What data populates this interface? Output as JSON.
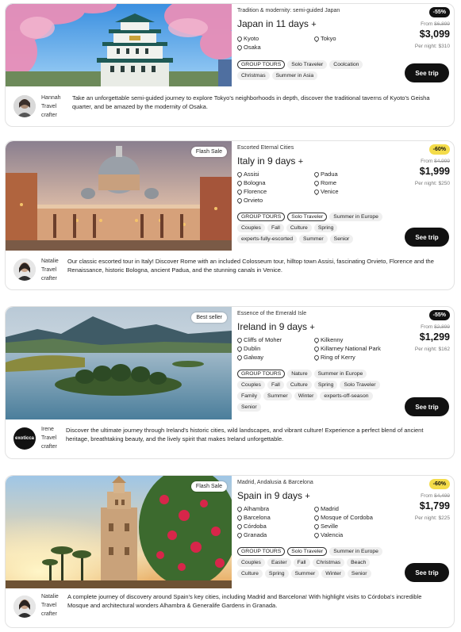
{
  "trips": [
    {
      "flag": "",
      "subtitle": "Tradition & modernity: semi-guided Japan",
      "title": "Japan in 11 days",
      "cities": [
        "Kyoto",
        "Tokyo",
        "Osaka"
      ],
      "tags": [
        {
          "label": "GROUP TOURS",
          "style": "outline"
        },
        {
          "label": "Solo Traveler",
          "style": "fill"
        },
        {
          "label": "Coolcation",
          "style": "fill"
        },
        {
          "label": "Christmas",
          "style": "fill"
        },
        {
          "label": "Summer in Asia",
          "style": "fill"
        }
      ],
      "discount": "-55%",
      "discount_style": "dark",
      "from_label": "From",
      "old_price": "$6,899",
      "price": "$3,099",
      "per_night": "Per night: $310",
      "cta": "See trip",
      "agent": [
        "Hannah",
        "Travel",
        "crafter"
      ],
      "description": "Take an unforgettable semi-guided journey to explore Tokyo's neighborhoods in depth, discover the traditional taverns of Kyoto's Geisha quarter, and be amazed by the modernity of Osaka."
    },
    {
      "flag": "Flash Sale",
      "subtitle": "Escorted Eternal Cities",
      "title": "Italy in 9 days",
      "cities": [
        "Assisi",
        "Padua",
        "Bologna",
        "Rome",
        "Florence",
        "Venice",
        "Orvieto"
      ],
      "tags": [
        {
          "label": "GROUP TOURS",
          "style": "outline"
        },
        {
          "label": "Solo Traveler",
          "style": "outline"
        },
        {
          "label": "Summer in Europe",
          "style": "fill"
        },
        {
          "label": "Couples",
          "style": "fill"
        },
        {
          "label": "Fall",
          "style": "fill"
        },
        {
          "label": "Culture",
          "style": "fill"
        },
        {
          "label": "Spring",
          "style": "fill"
        },
        {
          "label": "experts-fully-escorted",
          "style": "fill"
        },
        {
          "label": "Summer",
          "style": "fill"
        },
        {
          "label": "Senior",
          "style": "fill"
        }
      ],
      "discount": "-60%",
      "discount_style": "yellow",
      "from_label": "From",
      "old_price": "$4,999",
      "price": "$1,999",
      "per_night": "Per night: $250",
      "cta": "See trip",
      "agent": [
        "Natalie",
        "Travel",
        "crafter"
      ],
      "description": "Our classic escorted tour in Italy! Discover Rome with an included Colosseum tour, hilltop town Assisi, fascinating Orvieto, Florence and the Renaissance, historic Bologna, ancient Padua, and the stunning canals in Venice."
    },
    {
      "flag": "Best seller",
      "subtitle": "Essence of the Emerald Isle",
      "title": "Ireland in 9 days",
      "cities": [
        "Cliffs of Moher",
        "Kilkenny",
        "Dublin",
        "Killarney National Park",
        "Galway",
        "Ring of Kerry"
      ],
      "tags": [
        {
          "label": "GROUP TOURS",
          "style": "outline"
        },
        {
          "label": "Nature",
          "style": "fill"
        },
        {
          "label": "Summer in Europe",
          "style": "fill"
        },
        {
          "label": "Couples",
          "style": "fill"
        },
        {
          "label": "Fall",
          "style": "fill"
        },
        {
          "label": "Culture",
          "style": "fill"
        },
        {
          "label": "Spring",
          "style": "fill"
        },
        {
          "label": "Solo Traveler",
          "style": "fill"
        },
        {
          "label": "Family",
          "style": "fill"
        },
        {
          "label": "Summer",
          "style": "fill"
        },
        {
          "label": "Winter",
          "style": "fill"
        },
        {
          "label": "experts-off-season",
          "style": "fill"
        },
        {
          "label": "Senior",
          "style": "fill"
        }
      ],
      "discount": "-55%",
      "discount_style": "dark",
      "from_label": "From",
      "old_price": "$2,899",
      "price": "$1,299",
      "per_night": "Per night: $162",
      "cta": "See trip",
      "agent": [
        "Irene",
        "Travel",
        "crafter"
      ],
      "agent_logo": "exoticca",
      "description": "Discover the ultimate journey through Ireland's historic cities, wild landscapes, and vibrant culture! Experience a perfect blend of ancient heritage, breathtaking beauty, and the lively spirit that makes Ireland unforgettable."
    },
    {
      "flag": "Flash Sale",
      "subtitle": "Madrid, Andalusia & Barcelona",
      "title": "Spain in 9 days",
      "cities": [
        "Alhambra",
        "Madrid",
        "Barcelona",
        "Mosque of Cordoba",
        "Córdoba",
        "Seville",
        "Granada",
        "Valencia"
      ],
      "tags": [
        {
          "label": "GROUP TOURS",
          "style": "outline"
        },
        {
          "label": "Solo Traveler",
          "style": "outline"
        },
        {
          "label": "Summer in Europe",
          "style": "fill"
        },
        {
          "label": "Couples",
          "style": "fill"
        },
        {
          "label": "Easter",
          "style": "fill"
        },
        {
          "label": "Fall",
          "style": "fill"
        },
        {
          "label": "Christmas",
          "style": "fill"
        },
        {
          "label": "Beach",
          "style": "fill"
        },
        {
          "label": "Culture",
          "style": "fill"
        },
        {
          "label": "Spring",
          "style": "fill"
        },
        {
          "label": "Summer",
          "style": "fill"
        },
        {
          "label": "Winter",
          "style": "fill"
        },
        {
          "label": "Senior",
          "style": "fill"
        }
      ],
      "discount": "-60%",
      "discount_style": "yellow",
      "from_label": "From",
      "old_price": "$4,499",
      "price": "$1,799",
      "per_night": "Per night: $225",
      "cta": "See trip",
      "agent": [
        "Natalie",
        "Travel",
        "crafter"
      ],
      "description": "A complete journey of discovery around Spain's key cities, including Madrid and Barcelona! With highlight visits to Córdoba's incredible Mosque and architectural wonders Alhambra & Generalife Gardens in Granada."
    }
  ]
}
